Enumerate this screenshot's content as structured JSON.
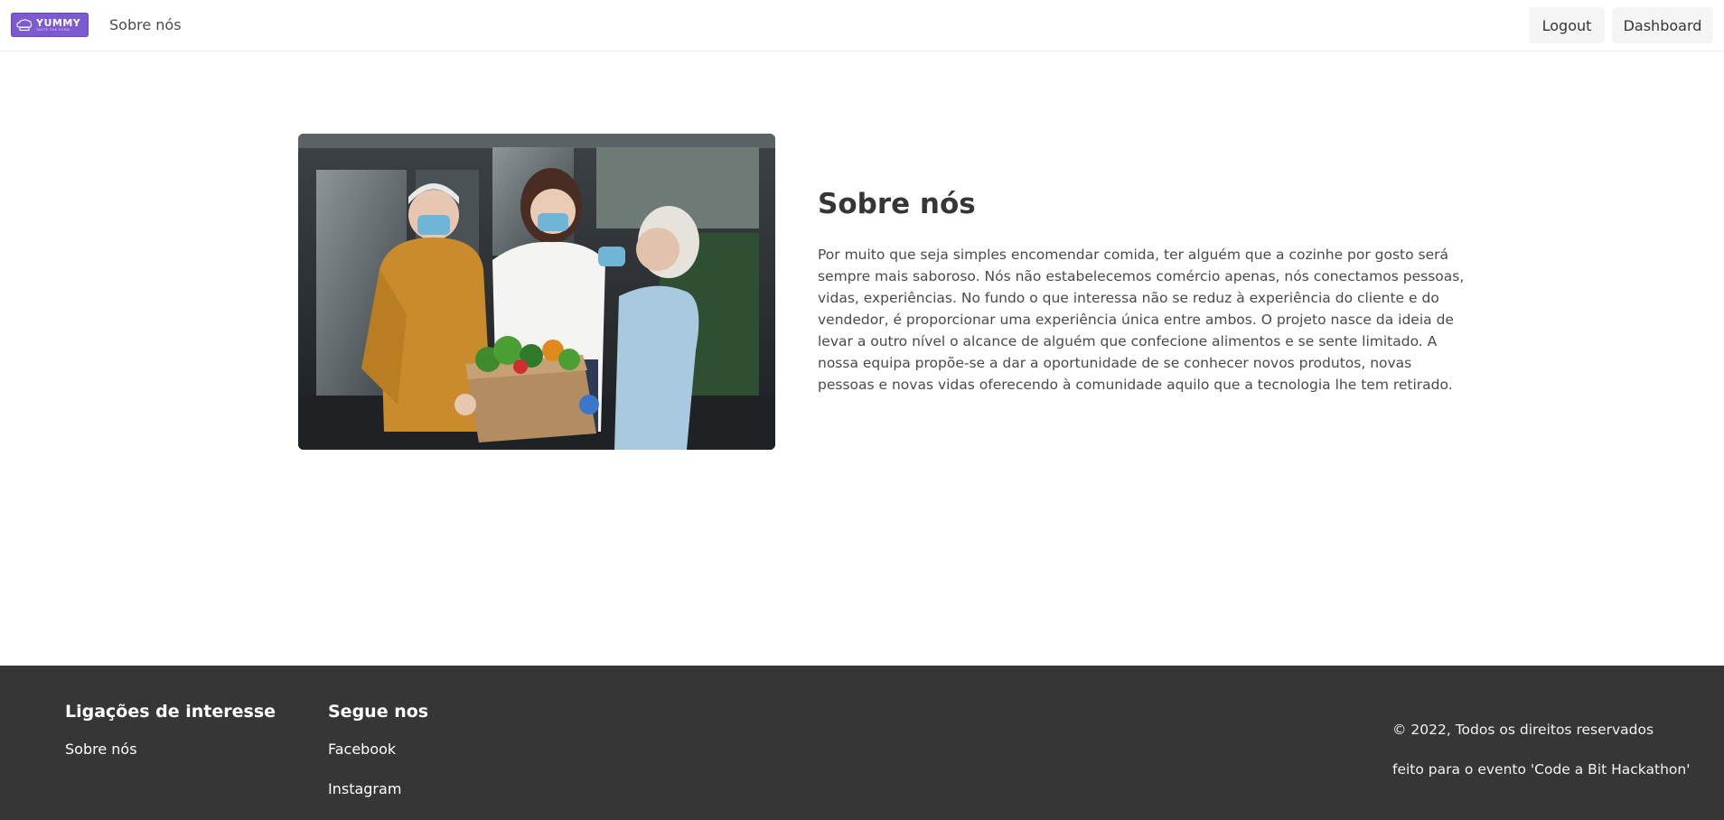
{
  "navbar": {
    "logo": {
      "title": "YUMMY",
      "subtitle": "TASTE THE FOOD"
    },
    "links": [
      {
        "label": "Sobre nós"
      }
    ],
    "buttons": {
      "logout": "Logout",
      "dashboard": "Dashboard"
    }
  },
  "about": {
    "title": "Sobre nós",
    "text": "Por muito que seja simples encomendar comida, ter alguém que a cozinhe por gosto será sempre mais saboroso. Nós não estabelecemos comércio apenas, nós conectamos pessoas, vidas, experiências. No fundo o que interessa não se reduz à experiência do cliente e do vendedor, é proporcionar uma experiência única entre ambos. O projeto nasce da ideia de levar a outro nível o alcance de alguém que confecione alimentos e se sente limitado. A nossa equipa propõe-se a dar a oportunidade de se conhecer novos produtos, novas pessoas e novas vidas oferecendo à comunidade aquilo que a tecnologia lhe tem retirado."
  },
  "footer": {
    "links_section": {
      "title": "Ligações de interesse",
      "items": [
        "Sobre nós"
      ]
    },
    "social_section": {
      "title": "Segue nos",
      "items": [
        "Facebook",
        "Instagram"
      ]
    },
    "copyright": "© 2022, Todos os direitos reservados",
    "event": "feito para o evento 'Code a Bit Hackathon'"
  },
  "colors": {
    "brand": "#7e5ad1",
    "footer_bg": "#363636",
    "button_bg": "#f5f5f5",
    "text": "#363636"
  },
  "icons": {
    "logo": "chef-hat-icon"
  }
}
